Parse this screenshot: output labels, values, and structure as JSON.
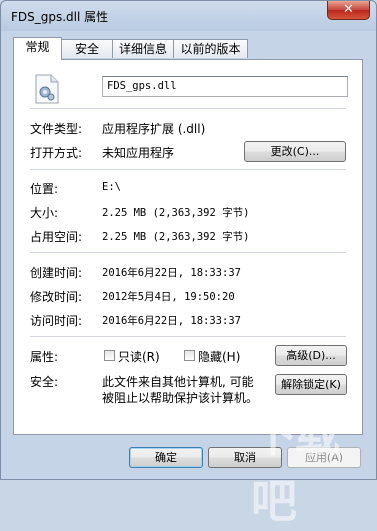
{
  "window": {
    "title": "FDS_gps.dll 属性",
    "close_label": "✕"
  },
  "tabs": [
    {
      "label": "常规"
    },
    {
      "label": "安全"
    },
    {
      "label": "详细信息"
    },
    {
      "label": "以前的版本"
    }
  ],
  "file": {
    "name": "FDS_gps.dll"
  },
  "rows": {
    "type_label": "文件类型:",
    "type_value": "应用程序扩展 (.dll)",
    "open_label": "打开方式:",
    "open_value": "未知应用程序",
    "change_button": "更改(C)...",
    "location_label": "位置:",
    "location_value": "E:\\",
    "size_label": "大小:",
    "size_value": "2.25 MB (2,363,392 字节)",
    "disk_label": "占用空间:",
    "disk_value": "2.25 MB (2,363,392 字节)",
    "created_label": "创建时间:",
    "created_value": "2016年6月22日, 18:33:37",
    "modified_label": "修改时间:",
    "modified_value": "2012年5月4日, 19:50:20",
    "accessed_label": "访问时间:",
    "accessed_value": "2016年6月22日, 18:33:37",
    "attr_label": "属性:",
    "readonly_label": "只读(R)",
    "hidden_label": "隐藏(H)",
    "advanced_button": "高级(D)...",
    "security_label": "安全:",
    "security_text_1": "此文件来自其他计算机, 可能",
    "security_text_2": "被阻止以帮助保护该计算机。",
    "unblock_button": "解除锁定(K)"
  },
  "footer": {
    "ok": "确定",
    "cancel": "取消",
    "apply": "应用(A)"
  },
  "watermark": "下载吧"
}
